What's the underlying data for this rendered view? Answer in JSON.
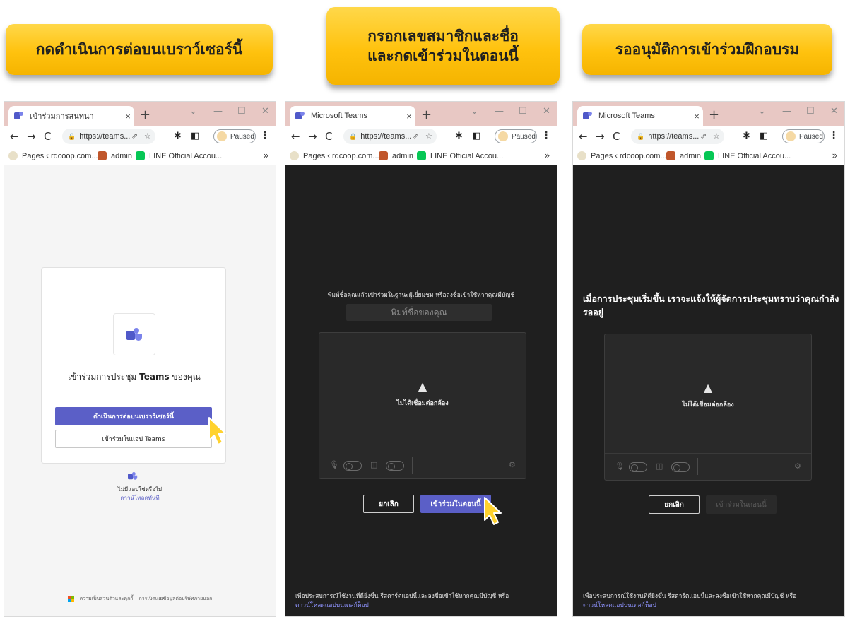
{
  "steps": [
    {
      "label": "กดดำเนินการต่อบนเบราว์เซอร์นี้"
    },
    {
      "label": "กรอกเลขสมาชิกและชื่อ\nและกดเข้าร่วมในตอนนี้"
    },
    {
      "label": "รออนุมัติการเข้าร่วมฝึกอบรม"
    }
  ],
  "browser": {
    "url": "https://teams...",
    "paused_label": "Paused",
    "new_tab": "+",
    "close_tab": "×",
    "more_bookmarks": "»",
    "bookmarks": [
      "Pages ‹ rdcoop.com...",
      "admin",
      "LINE Official Accou..."
    ]
  },
  "panel1": {
    "tab_title": "เข้าร่วมการสนทนา",
    "card_title_1": "เข้าร่วมการประชุม",
    "card_title_bold": "Teams",
    "card_title_2": "ของคุณ",
    "continue_button": "ดำเนินการต่อบนเบราว์เซอร์นี้",
    "open_app_button": "เข้าร่วมในแอป Teams",
    "no_app_text": "ไม่มีแอปใช่หรือไม่",
    "download_link": "ดาวน์โหลดทันที",
    "footer_privacy": "ความเป็นส่วนตัวและคุกกี้",
    "footer_third_party": "การเปิดเผยข้อมูลต่อบริษัทภายนอก"
  },
  "panel2": {
    "tab_title": "Microsoft Teams",
    "prompt": "พิมพ์ชื่อคุณแล้วเข้าร่วมในฐานะผู้เยี่ยมชม หรือลงชื่อเข้าใช้หากคุณมีบัญชี",
    "name_placeholder": "พิมพ์ชื่อของคุณ",
    "camera_off": "ไม่ได้เชื่อมต่อกล้อง",
    "cancel_button": "ยกเลิก",
    "join_button": "เข้าร่วมในตอนนี้",
    "bottom_note": "เพื่อประสบการณ์ใช้งานที่ดียิ่งขึ้น รีสตาร์ตแอปนี้และลงชื่อเข้าใช้หากคุณมีบัญชี หรือ",
    "bottom_link": "ดาวน์โหลดแอปบนเดสก์ท็อป"
  },
  "panel3": {
    "tab_title": "Microsoft Teams",
    "waiting_heading": "เมื่อการประชุมเริ่มขึ้น เราจะแจ้งให้ผู้จัดการประชุมทราบว่าคุณกำลังรออยู่",
    "camera_off": "ไม่ได้เชื่อมต่อกล้อง",
    "cancel_button": "ยกเลิก",
    "join_button": "เข้าร่วมในตอนนี้",
    "bottom_note": "เพื่อประสบการณ์ใช้งานที่ดียิ่งขึ้น รีสตาร์ตแอปนี้และลงชื่อเข้าใช้หากคุณมีบัญชี หรือ",
    "bottom_link": "ดาวน์โหลดแอปบนเดสก์ท็อป"
  },
  "colors": {
    "banner": "#ffc20e",
    "tab_strip": "#e8c8c4",
    "teams_purple": "#5b5fc7",
    "dark_bg": "#1f1f1f",
    "cursor": "#ffd22e"
  },
  "icons": [
    "teams-icon",
    "close-icon",
    "back-icon",
    "forward-icon",
    "reload-icon",
    "lock-icon",
    "share-icon",
    "star-icon",
    "extensions-icon",
    "sidepanel-icon",
    "profile-icon",
    "menu-icon",
    "warning-icon",
    "mic-off-icon",
    "camera-off-icon",
    "settings-icon",
    "pointer-cursor-icon",
    "microsoft-logo-icon"
  ]
}
